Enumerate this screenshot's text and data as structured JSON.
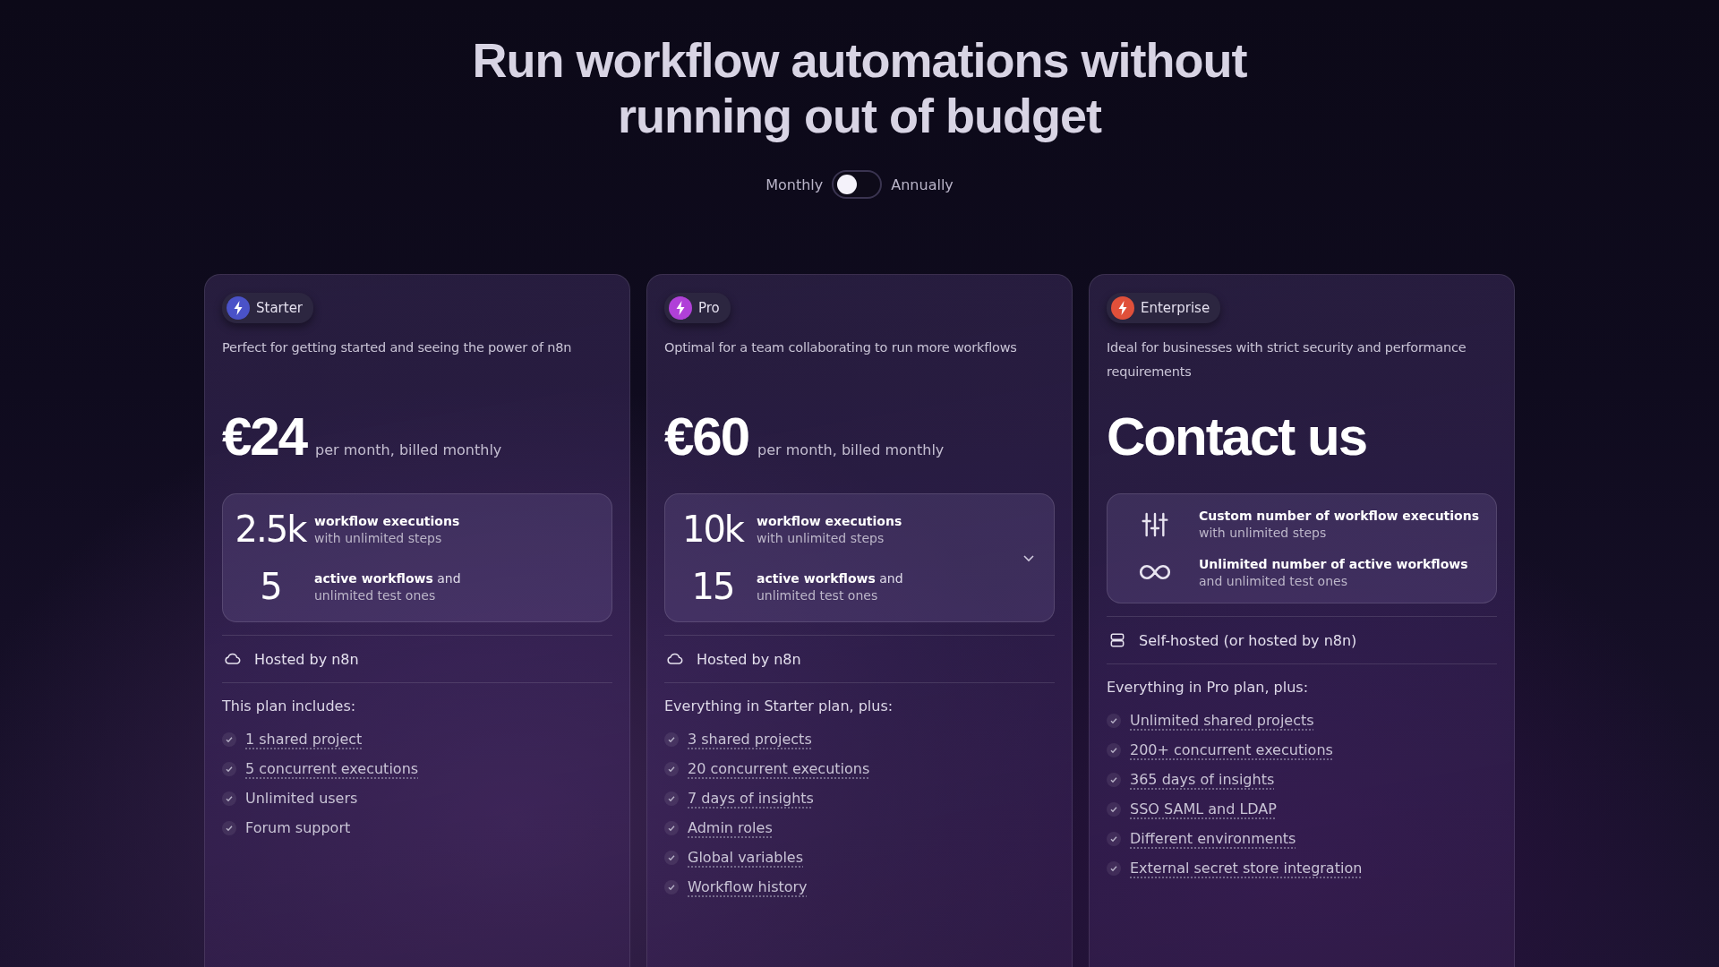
{
  "heading": "Run workflow automations without running out of budget",
  "billing": {
    "left": "Monthly",
    "right": "Annually",
    "on": false
  },
  "plans": [
    {
      "badge": "Starter",
      "color": "#4a52c8",
      "description": "Perfect for getting started and seeing the power of n8n",
      "price": "€24",
      "price_note": "per month, billed monthly",
      "expandable": false,
      "stats": [
        {
          "kind": "number",
          "value": "2.5k",
          "line1": "**workflow executions**",
          "line2": "with unlimited steps"
        },
        {
          "kind": "number",
          "value": "5",
          "line1": "**active workflows** and",
          "line2": "unlimited test ones"
        }
      ],
      "hosting": {
        "kind": "cloud",
        "label": "Hosted by n8n"
      },
      "includes_title": "This plan includes:",
      "features": [
        {
          "label": "1 shared project",
          "underlined": true
        },
        {
          "label": "5 concurrent executions",
          "underlined": true
        },
        {
          "label": "Unlimited users",
          "underlined": false
        },
        {
          "label": "Forum support",
          "underlined": false
        }
      ]
    },
    {
      "badge": "Pro",
      "color": "#b040d8",
      "description": "Optimal for a team collaborating to run more workflows",
      "price": "€60",
      "price_note": "per month, billed monthly",
      "expandable": true,
      "stats": [
        {
          "kind": "number",
          "value": "10k",
          "line1": "**workflow executions**",
          "line2": "with unlimited steps"
        },
        {
          "kind": "number",
          "value": "15",
          "line1": "**active workflows** and",
          "line2": "unlimited test ones"
        }
      ],
      "hosting": {
        "kind": "cloud",
        "label": "Hosted by n8n"
      },
      "includes_title": "Everything in Starter plan, plus:",
      "features": [
        {
          "label": "3 shared projects",
          "underlined": true
        },
        {
          "label": "20 concurrent executions",
          "underlined": true
        },
        {
          "label": "7 days of insights",
          "underlined": true
        },
        {
          "label": "Admin roles",
          "underlined": true
        },
        {
          "label": "Global variables",
          "underlined": true
        },
        {
          "label": "Workflow history",
          "underlined": true
        }
      ]
    },
    {
      "badge": "Enterprise",
      "color": "#e0503a",
      "description": "Ideal for businesses with strict security and performance requirements",
      "price": "Contact us",
      "expandable": false,
      "stats": [
        {
          "kind": "sliders",
          "line1": "**Custom number of workflow executions**",
          "line2": "with unlimited steps"
        },
        {
          "kind": "infinity",
          "line1": "**Unlimited number of active workflows**",
          "line2": "and unlimited test ones"
        }
      ],
      "hosting": {
        "kind": "server",
        "label": "Self-hosted (or hosted by n8n)"
      },
      "includes_title": "Everything in Pro plan, plus:",
      "features": [
        {
          "label": "Unlimited shared projects",
          "underlined": true
        },
        {
          "label": "200+ concurrent executions",
          "underlined": true
        },
        {
          "label": "365 days of insights",
          "underlined": true
        },
        {
          "label": "SSO SAML and LDAP",
          "underlined": true
        },
        {
          "label": "Different environments",
          "underlined": true
        },
        {
          "label": "External secret store integration",
          "underlined": true
        }
      ]
    }
  ]
}
